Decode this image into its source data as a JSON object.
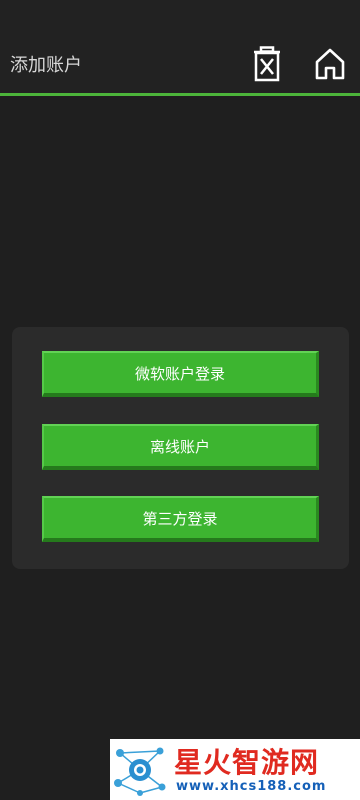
{
  "header": {
    "title": "添加账户",
    "delete_icon": "trash-x-icon",
    "home_icon": "home-icon"
  },
  "dialog": {
    "buttons": [
      {
        "label": "微软账户登录"
      },
      {
        "label": "离线账户"
      },
      {
        "label": "第三方登录"
      }
    ]
  },
  "watermark": {
    "name": "星火智游网",
    "url": "www.xhcs188.com"
  },
  "colors": {
    "accent": "#4cb43a",
    "button": "#3db530",
    "background": "#1f1f1f",
    "panel": "#2b2b2b"
  }
}
